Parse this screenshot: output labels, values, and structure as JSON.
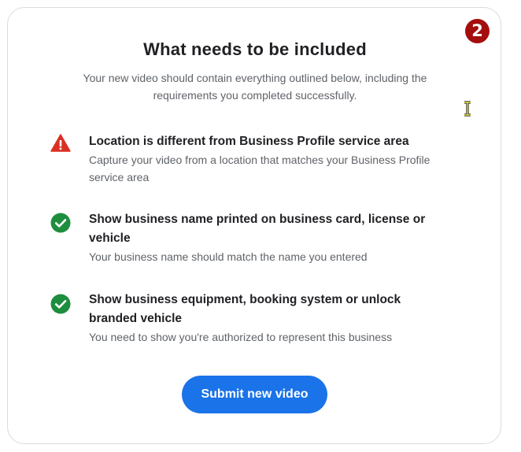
{
  "dialog": {
    "title": "What needs to be included",
    "subtitle": "Your new video should contain everything outlined below, including the requirements you completed successfully.",
    "step_badge": "2"
  },
  "requirements": [
    {
      "status": "error",
      "icon": "warning-icon",
      "heading": "Location is different from Business Profile service area",
      "description": "Capture your video from a location that matches your Business Profile service area"
    },
    {
      "status": "complete",
      "icon": "check-circle-icon",
      "heading": "Show business name printed on business card, license or vehicle",
      "description": "Your business name should match the name you entered"
    },
    {
      "status": "complete",
      "icon": "check-circle-icon",
      "heading": "Show business equipment, booking system or unlock branded vehicle",
      "description": "You need to show you're authorized to represent this business"
    }
  ],
  "actions": {
    "submit_label": "Submit new video"
  },
  "colors": {
    "accent": "#1a73e8",
    "error": "#d93025",
    "success": "#1e8e3e",
    "badge": "#a50e0e"
  }
}
